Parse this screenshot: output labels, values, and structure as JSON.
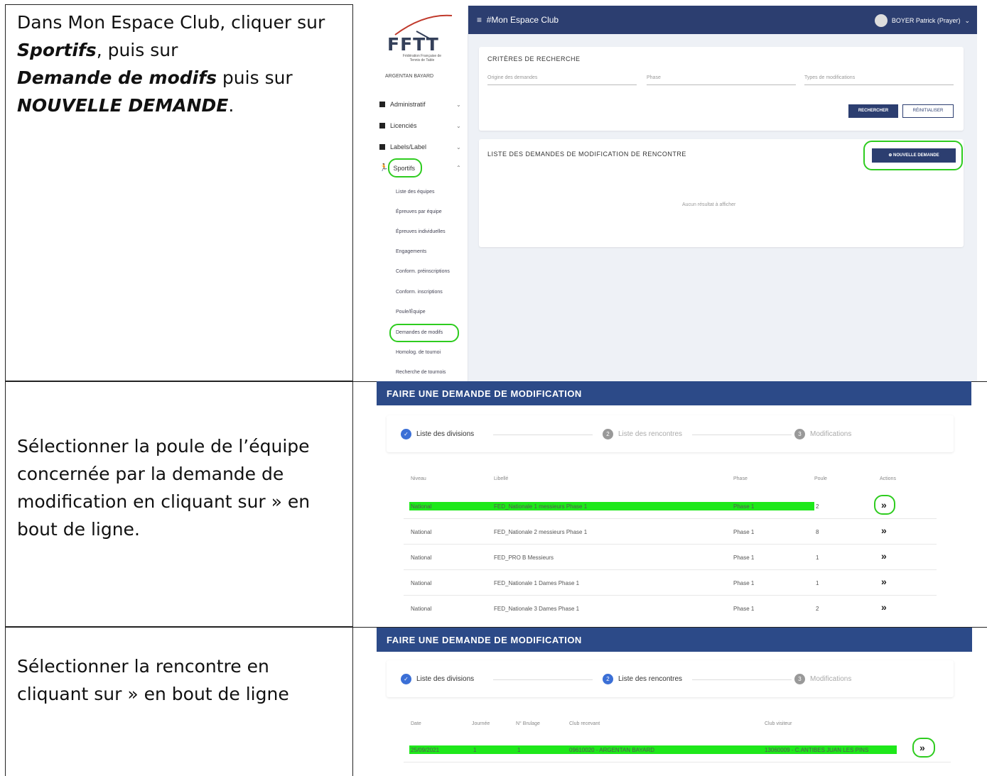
{
  "rows": [
    {
      "instruction": {
        "parts": [
          {
            "t": "Dans Mon Espace Club, cliquer sur ",
            "b": false
          },
          {
            "t": "Sportifs",
            "b": true
          },
          {
            "t": ", puis sur",
            "b": false
          },
          {
            "t": " Demande de modifs",
            "b": true
          },
          {
            "t": " puis sur ",
            "b": false
          },
          {
            "t": "NOUVELLE DEMANDE",
            "b": true
          },
          {
            "t": ".",
            "b": false
          }
        ]
      }
    },
    {
      "instruction": {
        "text": "Sélectionner la poule de l’équipe concernée par la demande de modification en cliquant sur » en bout de ligne."
      }
    },
    {
      "instruction": {
        "text": "Sélectionner la rencontre en cliquant sur » en bout de ligne"
      }
    }
  ],
  "app": {
    "logo": "FFTT",
    "logo_sub": "Fédération Française de Tennis de Table",
    "header_title": "#Mon Espace Club",
    "user": "BOYER Patrick (Prayer)",
    "club": "ARGENTAN BAYARD",
    "menu": [
      "Administratif",
      "Licenciés",
      "Labels/Label",
      "Sportifs"
    ],
    "submenu": [
      "Liste des équipes",
      "Épreuves par équipe",
      "Épreuves individuelles",
      "Engagements",
      "Conform. préinscriptions",
      "Conform. inscriptions",
      "Poule/Équipe",
      "Demandes de modifs",
      "Homolog. de tournoi",
      "Recherche de tournois"
    ],
    "search_title": "CRITÈRES DE RECHERCHE",
    "fields": [
      "Origine des demandes",
      "Phase",
      "Types de modifications"
    ],
    "btn_search": "RECHERCHER",
    "btn_reset": "RÉINITIALISER",
    "list_title": "LISTE DES DEMANDES DE MODIFICATION DE RENCONTRE",
    "btn_new": "NOUVELLE DEMANDE",
    "empty_text": "Aucun résultat à afficher"
  },
  "screen2": {
    "title": "FAIRE UNE DEMANDE DE MODIFICATION",
    "steps": [
      "Liste des divisions",
      "Liste des rencontres",
      "Modifications"
    ],
    "headers": [
      "Niveau",
      "Libellé",
      "Phase",
      "Poule",
      "Actions"
    ],
    "rows": [
      {
        "niveau": "National",
        "libelle": "FED_Nationale 1 messieurs Phase 1",
        "phase": "Phase 1",
        "poule": "2",
        "action": "»"
      },
      {
        "niveau": "National",
        "libelle": "FED_Nationale 2 messieurs Phase 1",
        "phase": "Phase 1",
        "poule": "8",
        "action": "»"
      },
      {
        "niveau": "National",
        "libelle": "FED_PRO B Messieurs",
        "phase": "Phase 1",
        "poule": "1",
        "action": "»"
      },
      {
        "niveau": "National",
        "libelle": "FED_Nationale 1 Dames Phase 1",
        "phase": "Phase 1",
        "poule": "1",
        "action": "»"
      },
      {
        "niveau": "National",
        "libelle": "FED_Nationale 3 Dames Phase 1",
        "phase": "Phase 1",
        "poule": "2",
        "action": "»"
      }
    ]
  },
  "screen3": {
    "title": "FAIRE UNE DEMANDE DE MODIFICATION",
    "steps": [
      "Liste des divisions",
      "Liste des rencontres",
      "Modifications"
    ],
    "headers": [
      "Date",
      "Journée",
      "N° Brulage",
      "Club recevant",
      "Club visiteur"
    ],
    "row": {
      "date": "25/09/2021",
      "journee": "1",
      "num": "1",
      "recevant": "09610020 - ARGENTAN BAYARD",
      "visiteur": "13060009 - C.ANTIBES JUAN LES PINS",
      "action": "»"
    }
  },
  "colors": {
    "header": "#2c3e70",
    "bar": "#2c4a88",
    "highlight": "#1ee81a",
    "circle": "#2ecc1f"
  }
}
